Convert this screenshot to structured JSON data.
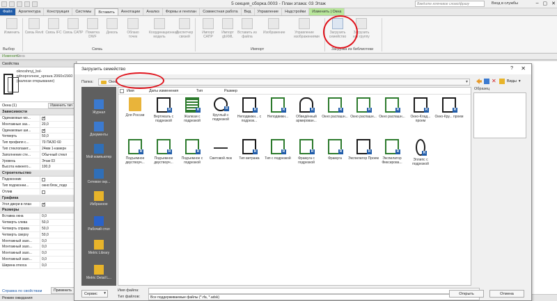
{
  "window": {
    "title": "5 секция_сборка.0003 - План этажа: 03 Этаж",
    "search_placeholder": "Введите ключевое слово/фразу",
    "login": "Вход в службы"
  },
  "ribbon_tabs": [
    {
      "label": "Файл",
      "kind": "file"
    },
    {
      "label": "Архитектура",
      "kind": ""
    },
    {
      "label": "Конструкция",
      "kind": ""
    },
    {
      "label": "Системы",
      "kind": ""
    },
    {
      "label": "Вставить",
      "kind": "active"
    },
    {
      "label": "Аннотации",
      "kind": ""
    },
    {
      "label": "Анализ",
      "kind": ""
    },
    {
      "label": "Формы и генплан",
      "kind": ""
    },
    {
      "label": "Совместная работа",
      "kind": ""
    },
    {
      "label": "Вид",
      "kind": ""
    },
    {
      "label": "Управление",
      "kind": ""
    },
    {
      "label": "Надстройки",
      "kind": ""
    },
    {
      "label": "Изменить | Окна",
      "kind": "context"
    }
  ],
  "ribbon": {
    "buttons": [
      {
        "name": "modify-button",
        "label": "Изменить",
        "hl": false
      },
      {
        "name": "link-revit-button",
        "label": "Связь Revit",
        "hl": false
      },
      {
        "name": "link-ifc-button",
        "label": "Связь IFC",
        "hl": false
      },
      {
        "name": "link-cad-button",
        "label": "Связь САПР",
        "hl": false
      },
      {
        "name": "link-dwf-button",
        "label": "Пометка DWF",
        "hl": false
      },
      {
        "name": "decal-button",
        "label": "Деколь",
        "hl": false
      },
      {
        "name": "point-cloud-button",
        "label": "Облако точек",
        "hl": false
      },
      {
        "name": "coordination-model-button",
        "label": "Координационная модель",
        "hl": false
      },
      {
        "name": "manage-links-button",
        "label": "Диспетчер связей",
        "hl": false
      },
      {
        "name": "import-cad-button",
        "label": "Импорт САПР",
        "hl": false
      },
      {
        "name": "import-gbxml-button",
        "label": "Импорт gbXML",
        "hl": false
      },
      {
        "name": "insert-from-file-button",
        "label": "Вставить из файла",
        "hl": false
      },
      {
        "name": "image-button",
        "label": "Изображение",
        "hl": false
      },
      {
        "name": "manage-images-button",
        "label": "Управление изображениями",
        "hl": false
      },
      {
        "name": "load-family-button",
        "label": "Загрузить семейство",
        "hl": true
      },
      {
        "name": "load-as-group-button",
        "label": "Загрузить как группу",
        "hl": false
      }
    ],
    "panels": [
      "Выбор",
      "Связь",
      "Импорт",
      "Загрузка из библиотеки"
    ]
  },
  "optbar": {
    "modify": "Изменить",
    "mode": "Окна"
  },
  "properties": {
    "header": "Свойства",
    "type_name": "oknoshnyj_bsl-odnoproлное_sprava 2060x1560 (жалюзи открывание)",
    "selector": "Окна (1)",
    "edit_type": "Изменить тип",
    "groups": [
      {
        "title": "Зависимости",
        "rows": [
          {
            "k": "Одинаковые мо...",
            "v": "",
            "check": "on"
          },
          {
            "k": "Монтажные заз...",
            "v": "20,0",
            "check": ""
          },
          {
            "k": "Одинаковые ши...",
            "v": "",
            "check": "on"
          },
          {
            "k": "Четверть",
            "v": "50,0",
            "check": ""
          },
          {
            "k": "Тип профиля с...",
            "v": "70 ПАЗО 60",
            "check": ""
          },
          {
            "k": "Тип стеклопакет...",
            "v": "24мм 1-камерн",
            "check": ""
          },
          {
            "k": "Заполнение сте...",
            "v": "Обычный стекл",
            "check": ""
          },
          {
            "k": "Уровень",
            "v": "Этаж 03",
            "check": ""
          },
          {
            "k": "Высота нижнего...",
            "v": "100,0",
            "check": ""
          }
        ]
      },
      {
        "title": "Строительство",
        "rows": [
          {
            "k": "Подоконник",
            "v": "",
            "check": "off"
          },
          {
            "k": "Тип подоконни...",
            "v": "окно:блок_подо",
            "check": ""
          },
          {
            "k": "Отлив",
            "v": "",
            "check": "off"
          }
        ]
      },
      {
        "title": "Графика",
        "rows": [
          {
            "k": "Угол двери в план",
            "v": "",
            "check": "on"
          }
        ]
      },
      {
        "title": "Размеры",
        "rows": [
          {
            "k": "Вставка окна",
            "v": "0,0",
            "check": ""
          },
          {
            "k": "Четверть слева",
            "v": "50,0",
            "check": ""
          },
          {
            "k": "Четверть справа",
            "v": "50,0",
            "check": ""
          },
          {
            "k": "Четверть сверху",
            "v": "50,0",
            "check": ""
          },
          {
            "k": "Монтажный зазо...",
            "v": "0,0",
            "check": ""
          },
          {
            "k": "Монтажный зазо...",
            "v": "0,0",
            "check": ""
          },
          {
            "k": "Монтажный зазо...",
            "v": "0,0",
            "check": ""
          },
          {
            "k": "Монтажный зазо...",
            "v": "0,0",
            "check": ""
          },
          {
            "k": "Ширина откоса",
            "v": "0,0",
            "check": ""
          }
        ]
      }
    ],
    "help_link": "Справка по свойствам",
    "apply": "Применить"
  },
  "status": {
    "text": "Режим ожидания"
  },
  "dialog": {
    "title": "Загрузить семейство",
    "help": "?",
    "close": "✕",
    "path_label": "Папка:",
    "path_value": "Окна",
    "views_label": "Виды",
    "places": [
      {
        "label": "Журнал",
        "color": "#3b7ad0"
      },
      {
        "label": "Документы",
        "color": "#3b7ad0"
      },
      {
        "label": "Мой компьютер",
        "color": "#2f6fb8"
      },
      {
        "label": "Сетевое окр...",
        "color": "#2f6fb8"
      },
      {
        "label": "Избранное",
        "color": "#e8b42a"
      },
      {
        "label": "Рабочий стол",
        "color": "#2a62c8"
      },
      {
        "label": "Metric Library",
        "color": "#e8b42a"
      },
      {
        "label": "Metric Detail L...",
        "color": "#e8b42a"
      }
    ],
    "columns": [
      "Имя",
      "Даты изменения",
      "Тип",
      "Размер"
    ],
    "files": [
      {
        "label": "Для России",
        "icon": "folder"
      },
      {
        "label": "Вертикаль с подрезкой",
        "icon": "win-dark"
      },
      {
        "label": "Жалюзи с подрезкой",
        "icon": "blinds"
      },
      {
        "label": "Круглый с подрезкой",
        "icon": "circle"
      },
      {
        "label": "Неподвижн... с подрезк...",
        "icon": "win-dark"
      },
      {
        "label": "Неподвижн...",
        "icon": "win"
      },
      {
        "label": "Обведённый армирован...",
        "icon": "arch"
      },
      {
        "label": "Окно распашн...",
        "icon": "win"
      },
      {
        "label": "Окно распашн...",
        "icon": "win"
      },
      {
        "label": "Окно распашн...",
        "icon": "win"
      },
      {
        "label": "Окно-Клад... проем",
        "icon": "win-dark"
      },
      {
        "label": "Окно-Кру... проем",
        "icon": "win-dark"
      },
      {
        "label": "Подъемное двустворч...",
        "icon": "win"
      },
      {
        "label": "Подъемное двустворч...",
        "icon": "win"
      },
      {
        "label": "Подъемное с подрезкой",
        "icon": "win"
      },
      {
        "label": "Световой люк",
        "icon": "sill"
      },
      {
        "label": "Тип витража",
        "icon": "win-dark"
      },
      {
        "label": "Тип с подрезкой",
        "icon": "win"
      },
      {
        "label": "Фрамуга с подрезкой",
        "icon": "win"
      },
      {
        "label": "Фрамуга",
        "icon": "win"
      },
      {
        "label": "Экспилатор Проем",
        "icon": "win-dark"
      },
      {
        "label": "Экспилатор Фиксирова...",
        "icon": "win"
      },
      {
        "label": "Эллипс с подрезкой",
        "icon": "ellipse"
      }
    ],
    "preview_label": "Образец",
    "filename_label": "Имя файла:",
    "filename_value": "",
    "filetype_label": "Тип файлов:",
    "filetype_value": "Все поддерживаемые файлы (*.rfa, *.adsk)",
    "service_button": "Сервис",
    "ok_button": "Открыть",
    "cancel_button": "Отмена"
  }
}
